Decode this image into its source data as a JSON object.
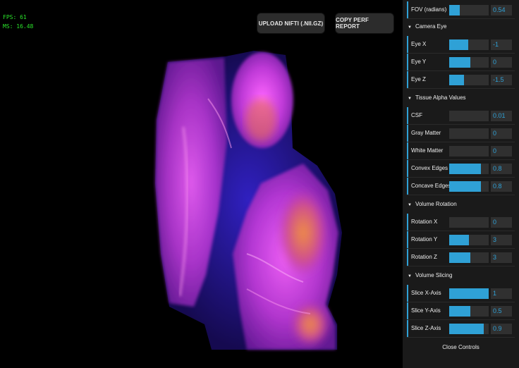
{
  "stats": {
    "fps": "FPS: 61",
    "ms": "MS: 16.48"
  },
  "toolbar": {
    "upload_label": "UPLOAD NIFTI (.NII.GZ)",
    "perf_label": "COPY PERF REPORT"
  },
  "controls": {
    "fov": {
      "label": "FOV (radians)",
      "value": "0.54",
      "fraction": 0.27
    },
    "camera_eye": {
      "title": "Camera Eye",
      "items": [
        {
          "label": "Eye X",
          "value": "-1",
          "fraction": 0.48
        },
        {
          "label": "Eye Y",
          "value": "0",
          "fraction": 0.54
        },
        {
          "label": "Eye Z",
          "value": "-1.5",
          "fraction": 0.38
        }
      ]
    },
    "tissue_alpha": {
      "title": "Tissue Alpha Values",
      "items": [
        {
          "label": "CSF",
          "value": "0.01",
          "fraction": 0.0
        },
        {
          "label": "Gray Matter",
          "value": "0",
          "fraction": 0.0
        },
        {
          "label": "White Matter",
          "value": "0",
          "fraction": 0.0
        },
        {
          "label": "Convex Edges",
          "value": "0.8",
          "fraction": 0.8
        },
        {
          "label": "Concave Edges",
          "value": "0.8",
          "fraction": 0.8
        }
      ]
    },
    "volume_rotation": {
      "title": "Volume Rotation",
      "items": [
        {
          "label": "Rotation X",
          "value": "0",
          "fraction": 0.0
        },
        {
          "label": "Rotation Y",
          "value": "3",
          "fraction": 0.5
        },
        {
          "label": "Rotation Z",
          "value": "3",
          "fraction": 0.54
        }
      ]
    },
    "volume_slicing": {
      "title": "Volume Slicing",
      "items": [
        {
          "label": "Slice X-Axis",
          "value": "1",
          "fraction": 1.0
        },
        {
          "label": "Slice Y-Axis",
          "value": "0.5",
          "fraction": 0.54
        },
        {
          "label": "Slice Z-Axis",
          "value": "0.9",
          "fraction": 0.88
        }
      ]
    },
    "close_label": "Close Controls"
  },
  "colors": {
    "accent": "#2fa1d6",
    "panel_bg": "#1a1a1a",
    "stats_text": "#2be52b",
    "volume_magenta": "#d040e0",
    "volume_orange": "#e07030"
  }
}
